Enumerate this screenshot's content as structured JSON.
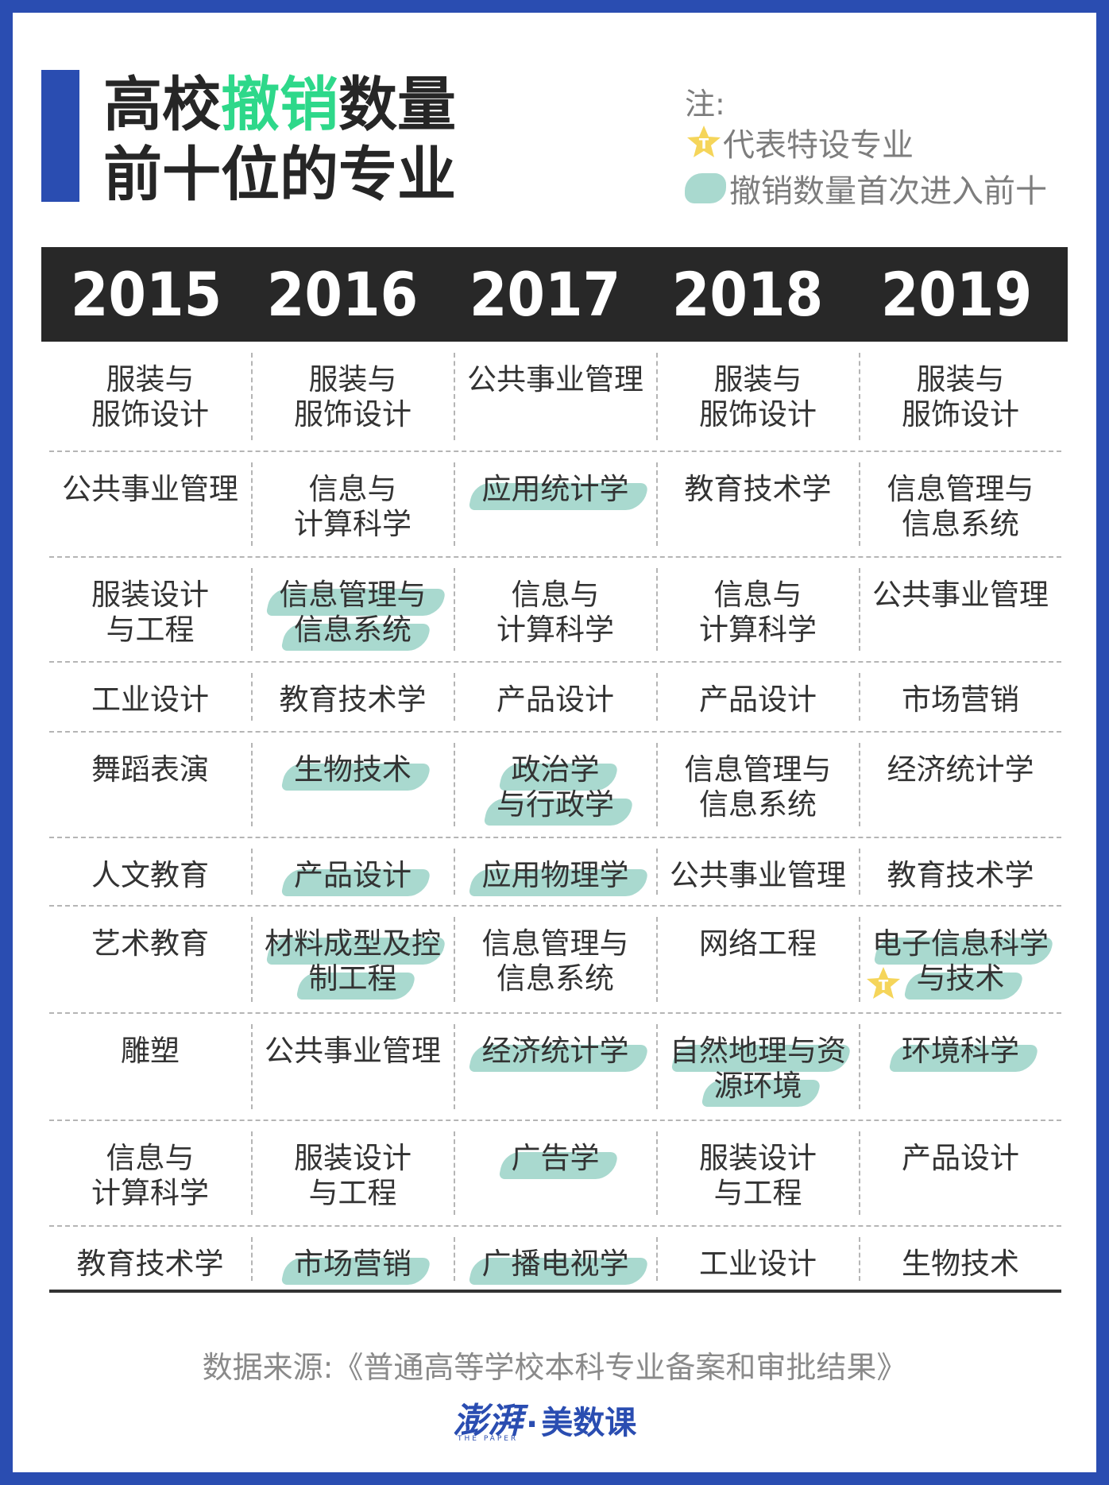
{
  "title": {
    "line1_prefix": "高校",
    "line1_highlight": "撤销",
    "line1_suffix": "数量",
    "line2": "前十位的专业"
  },
  "colors": {
    "frame": "#2a4db1",
    "title_highlight": "#2ed88a",
    "brush": "#a9d9cf",
    "header_bg": "#282828"
  },
  "notes": {
    "heading": "注:",
    "star_label": "代表特设专业",
    "brush_label": "撤销数量首次进入前十",
    "star_icon": "star-t-icon",
    "brush_icon": "brush-stroke-icon"
  },
  "years": [
    "2015",
    "2016",
    "2017",
    "2018",
    "2019"
  ],
  "table": [
    [
      {
        "lines": [
          "服装与",
          "服饰设计"
        ]
      },
      {
        "lines": [
          "服装与",
          "服饰设计"
        ]
      },
      {
        "lines": [
          "公共事业管理"
        ]
      },
      {
        "lines": [
          "服装与",
          "服饰设计"
        ]
      },
      {
        "lines": [
          "服装与",
          "服饰设计"
        ]
      }
    ],
    [
      {
        "lines": [
          "公共事业管理"
        ]
      },
      {
        "lines": [
          "信息与",
          "计算科学"
        ]
      },
      {
        "lines": [
          "应用统计学"
        ],
        "new": true
      },
      {
        "lines": [
          "教育技术学"
        ]
      },
      {
        "lines": [
          "信息管理与",
          "信息系统"
        ]
      }
    ],
    [
      {
        "lines": [
          "服装设计",
          "与工程"
        ]
      },
      {
        "lines": [
          "信息管理与",
          "信息系统"
        ],
        "new": true
      },
      {
        "lines": [
          "信息与",
          "计算科学"
        ]
      },
      {
        "lines": [
          "信息与",
          "计算科学"
        ]
      },
      {
        "lines": [
          "公共事业管理"
        ]
      }
    ],
    [
      {
        "lines": [
          "工业设计"
        ]
      },
      {
        "lines": [
          "教育技术学"
        ]
      },
      {
        "lines": [
          "产品设计"
        ]
      },
      {
        "lines": [
          "产品设计"
        ]
      },
      {
        "lines": [
          "市场营销"
        ]
      }
    ],
    [
      {
        "lines": [
          "舞蹈表演"
        ]
      },
      {
        "lines": [
          "生物技术"
        ],
        "new": true
      },
      {
        "lines": [
          "政治学",
          "与行政学"
        ],
        "new": true
      },
      {
        "lines": [
          "信息管理与",
          "信息系统"
        ]
      },
      {
        "lines": [
          "经济统计学"
        ]
      }
    ],
    [
      {
        "lines": [
          "人文教育"
        ]
      },
      {
        "lines": [
          "产品设计"
        ],
        "new": true
      },
      {
        "lines": [
          "应用物理学"
        ],
        "new": true
      },
      {
        "lines": [
          "公共事业管理"
        ]
      },
      {
        "lines": [
          "教育技术学"
        ]
      }
    ],
    [
      {
        "lines": [
          "艺术教育"
        ]
      },
      {
        "lines": [
          "材料成型及控",
          "制工程"
        ],
        "new": true
      },
      {
        "lines": [
          "信息管理与",
          "信息系统"
        ]
      },
      {
        "lines": [
          "网络工程"
        ]
      },
      {
        "lines": [
          "电子信息科学",
          "与技术"
        ],
        "new": true,
        "special": true
      }
    ],
    [
      {
        "lines": [
          "雕塑"
        ]
      },
      {
        "lines": [
          "公共事业管理"
        ]
      },
      {
        "lines": [
          "经济统计学"
        ],
        "new": true
      },
      {
        "lines": [
          "自然地理与资",
          "源环境"
        ],
        "new": true
      },
      {
        "lines": [
          "环境科学"
        ],
        "new": true
      }
    ],
    [
      {
        "lines": [
          "信息与",
          "计算科学"
        ]
      },
      {
        "lines": [
          "服装设计",
          "与工程"
        ]
      },
      {
        "lines": [
          "广告学"
        ],
        "new": true
      },
      {
        "lines": [
          "服装设计",
          "与工程"
        ]
      },
      {
        "lines": [
          "产品设计"
        ]
      }
    ],
    [
      {
        "lines": [
          "教育技术学"
        ]
      },
      {
        "lines": [
          "市场营销"
        ],
        "new": true
      },
      {
        "lines": [
          "广播电视学"
        ],
        "new": true
      },
      {
        "lines": [
          "工业设计"
        ]
      },
      {
        "lines": [
          "生物技术"
        ]
      }
    ]
  ],
  "source": "数据来源:《普通高等学校本科专业备案和审批结果》",
  "logo": {
    "brand": "澎湃",
    "separator": "·",
    "column": "美数课",
    "sub": "THE PAPER"
  }
}
